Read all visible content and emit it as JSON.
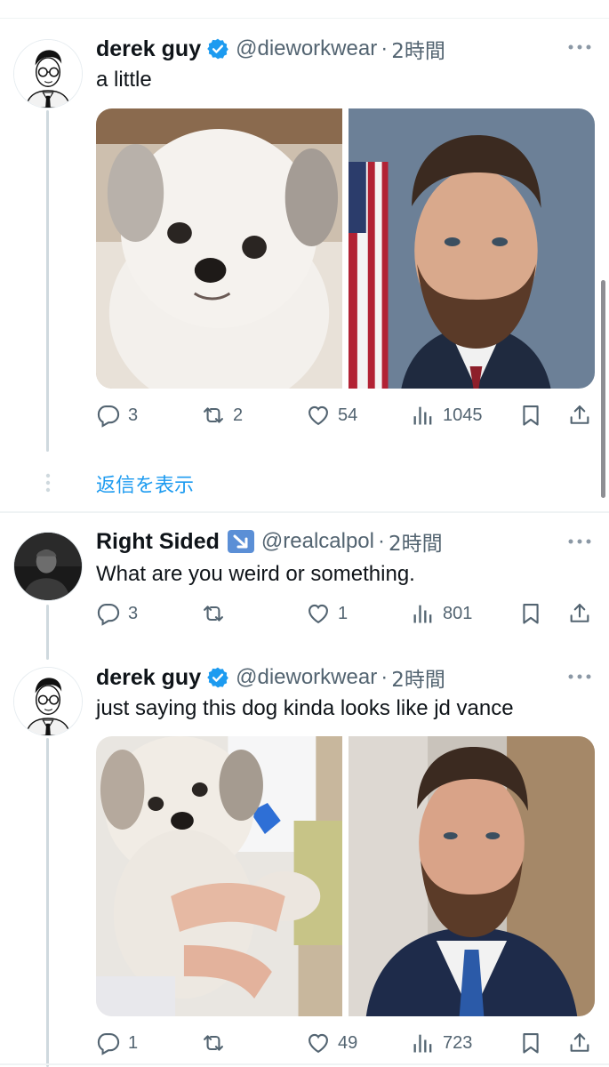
{
  "tweets": [
    {
      "name": "derek guy",
      "handle": "@dieworkwear",
      "time": "2時間",
      "text": "a little",
      "replies": "3",
      "retweets": "2",
      "likes": "54",
      "views": "1045"
    },
    {
      "name": "Right Sided",
      "handle": "@realcalpol",
      "time": "2時間",
      "text": "What are you weird or something.",
      "replies": "3",
      "retweets": "",
      "likes": "1",
      "views": "801"
    },
    {
      "name": "derek guy",
      "handle": "@dieworkwear",
      "time": "2時間",
      "text": "just saying this dog kinda looks like jd vance",
      "replies": "1",
      "retweets": "",
      "likes": "49",
      "views": "723"
    }
  ],
  "show_replies": "返信を表示",
  "colors": {
    "accent": "#1d9bf0",
    "muted": "#536471",
    "text": "#0f1419"
  }
}
